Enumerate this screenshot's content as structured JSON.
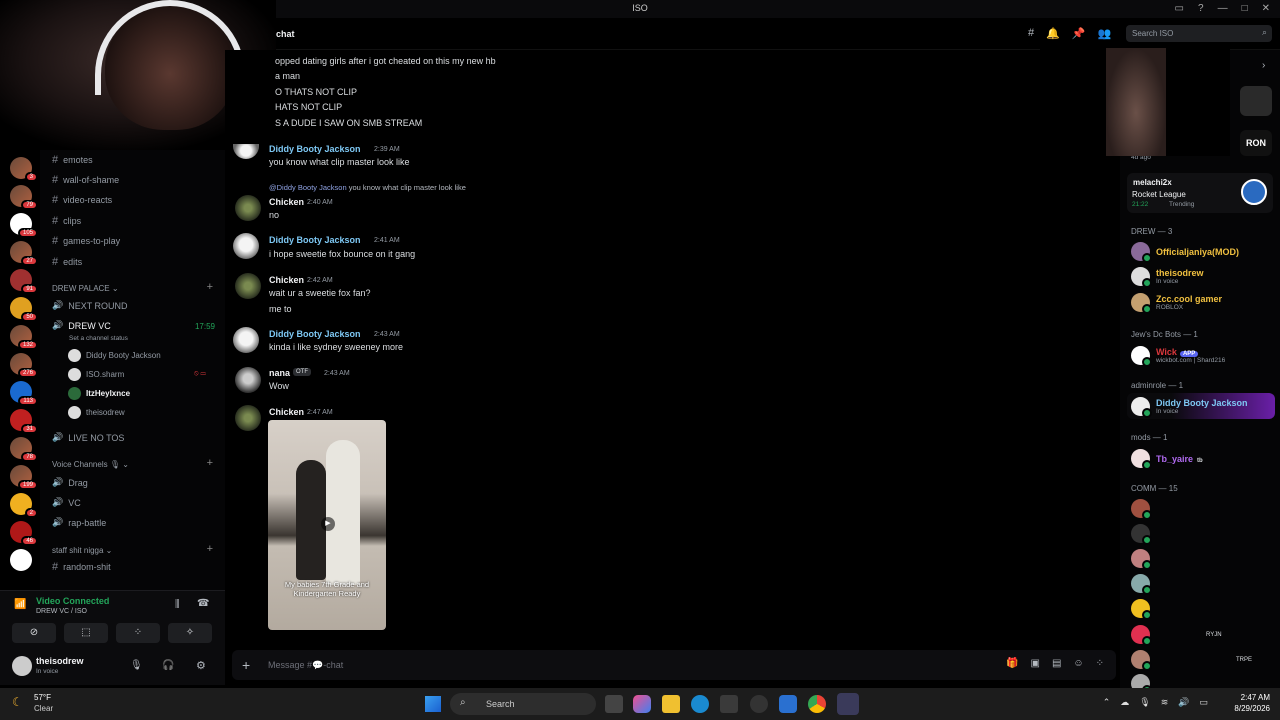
{
  "window": {
    "title": "ISO"
  },
  "channel_header": {
    "name": "chat",
    "search_placeholder": "Search ISO"
  },
  "channels": {
    "items": [
      {
        "name": "emotes"
      },
      {
        "name": "wall-of-shame"
      },
      {
        "name": "video-reacts"
      },
      {
        "name": "clips"
      },
      {
        "name": "games-to-play"
      },
      {
        "name": "edits"
      }
    ],
    "drew_palace": {
      "category": "DREW PALACE",
      "next_round": "NEXT ROUND",
      "drew_vc": "DREW VC",
      "vc_time": "17:59",
      "status_hint": "Set a channel status",
      "users": [
        "Diddy Booty Jackson",
        "ISO.sharm",
        "ItzHeylxnce",
        "theisodrew"
      ],
      "live_no_tos": "LIVE NO TOS"
    },
    "voice_category": "Voice Channels",
    "voice_items": [
      "Drag",
      "VC",
      "rap-battle"
    ],
    "staff_category": "staff shit nigga",
    "staff_items": [
      "random-shit"
    ]
  },
  "guild_badges": [
    "3",
    "79",
    "105",
    "27",
    "91",
    "50",
    "132",
    "276",
    "113",
    "31",
    "78",
    "199",
    "2",
    "46"
  ],
  "voice_panel": {
    "status": "Video Connected",
    "location": "DREW VC / ISO"
  },
  "user_panel": {
    "name": "theisodrew",
    "status": "In voice"
  },
  "messages": {
    "cut_lines": [
      "opped dating girls after i got cheated on this my new hb",
      "a man",
      "O THATS NOT CLIP",
      "HATS NOT CLIP",
      "S A DUDE I SAW ON SMB STREAM"
    ],
    "m1": {
      "author": "Diddy Booty Jackson",
      "time": "2:39 AM",
      "text": "you know what clip master look like"
    },
    "m2": {
      "reply_mention": "@Diddy Booty Jackson",
      "reply_text": "you know what clip master look like",
      "author": "Chicken",
      "time": "2:40 AM",
      "text": "no"
    },
    "m3": {
      "author": "Diddy Booty Jackson",
      "time": "2:41 AM",
      "text": "i hope sweetie fox bounce on it gang"
    },
    "m4": {
      "author": "Chicken",
      "time": "2:42 AM",
      "text": "wait ur a sweetie fox fan?",
      "text2": "me to"
    },
    "m5": {
      "author": "Diddy Booty Jackson",
      "time": "2:43 AM",
      "text": "kinda i like sydney sweeney more"
    },
    "m6": {
      "author": "nana",
      "tag": "OTF",
      "time": "2:43 AM",
      "text": "Wow"
    },
    "m7": {
      "author": "Chicken",
      "time": "2:47 AM",
      "video_caption": "My babies 7th Grade and Kindergarten Ready"
    }
  },
  "composer": {
    "placeholder": "Message #💬-chat"
  },
  "members": {
    "activity_top": "4d ago",
    "activity": {
      "name": "melachi2x",
      "game": "Rocket League",
      "time": "21:22",
      "trend": "Trending"
    },
    "drew_header": "DREW — 3",
    "drew": [
      {
        "name": "Officialjaniya(MOD)",
        "sub": ""
      },
      {
        "name": "theisodrew",
        "sub": "In voice"
      },
      {
        "name": "Zcc.cool gamer",
        "sub": "ROBLOX"
      }
    ],
    "bots_header": "Jew's Dc Bots — 1",
    "bot": {
      "name": "Wick",
      "badge": "APP",
      "sub": "wickbot.com | Shard216"
    },
    "admin_header": "adminrole — 1",
    "admin": {
      "name": "Diddy Booty Jackson",
      "sub": "In voice"
    },
    "mods_header": "mods — 1",
    "mod": {
      "name": "Tb_yaire",
      "tag": "tb"
    },
    "comm_header": "COMM — 15",
    "comm_tags": [
      "RYJN",
      "TRPE"
    ]
  },
  "taskbar": {
    "temp": "57°F",
    "weather": "Clear",
    "search": "Search",
    "time": "2:47 AM",
    "date": "8/29/2026"
  },
  "colors": {
    "author_diddy": "#7ec8f4",
    "voice_green": "#23a55a",
    "mod_gold": "#f0c040",
    "admin_highlight": "#6a1fa8"
  }
}
